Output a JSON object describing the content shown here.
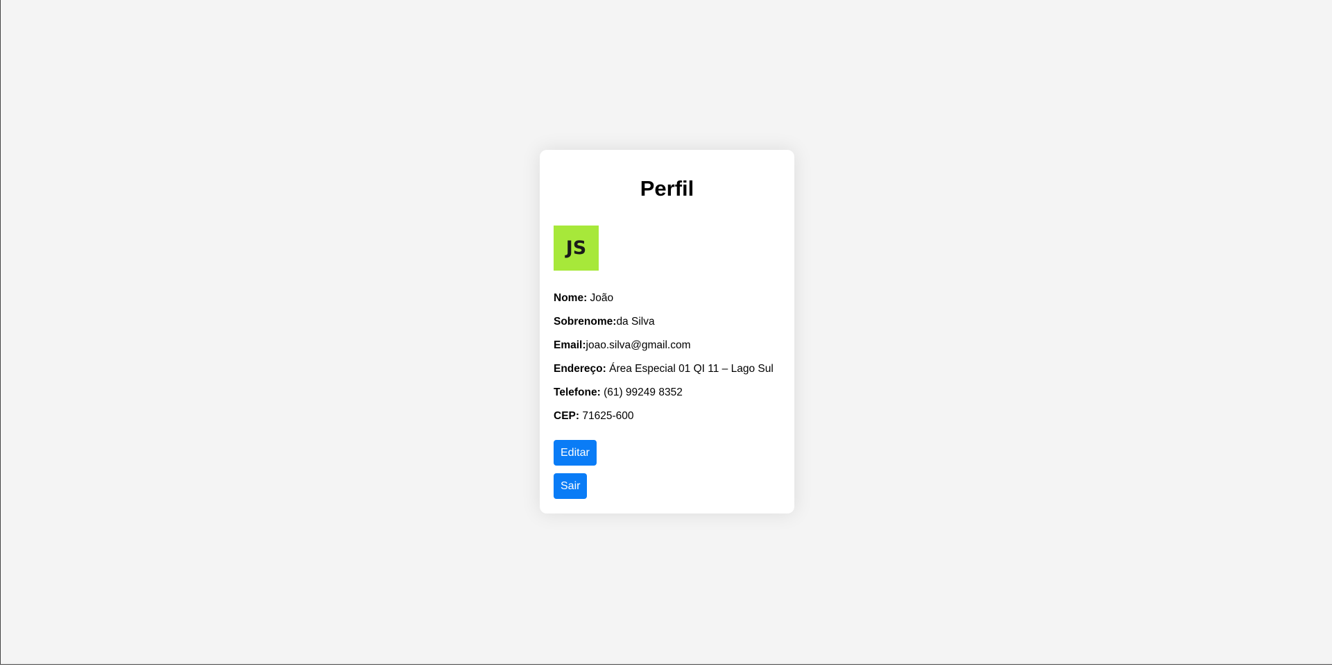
{
  "profile": {
    "title": "Perfil",
    "avatar": {
      "initials": "JS",
      "color": "#a7e83a"
    },
    "fields": [
      {
        "label": "Nome:",
        "sep": " ",
        "value": "João"
      },
      {
        "label": "Sobrenome:",
        "sep": "",
        "value": "da Silva"
      },
      {
        "label": "Email:",
        "sep": "",
        "value": "joao.silva@gmail.com"
      },
      {
        "label": "Endereço:",
        "sep": " ",
        "value": "Área Especial 01 QI 11 – Lago Sul"
      },
      {
        "label": "Telefone:",
        "sep": " ",
        "value": "(61) 99249 8352"
      },
      {
        "label": "CEP:",
        "sep": " ",
        "value": "71625-600"
      }
    ],
    "buttons": {
      "edit_label": "Editar",
      "exit_label": "Sair"
    }
  },
  "colors": {
    "page_background": "#f4f4f4",
    "card_background": "#ffffff",
    "button_primary": "#0a7cf6"
  }
}
